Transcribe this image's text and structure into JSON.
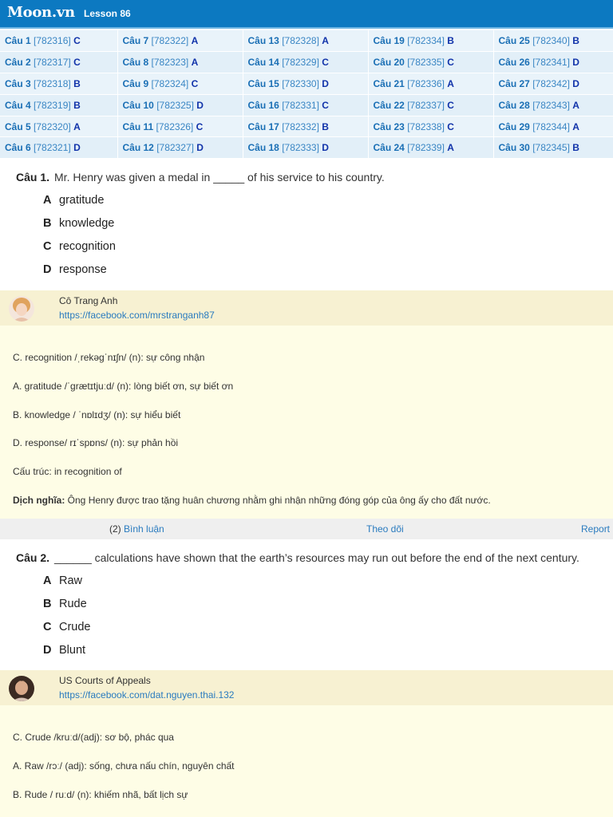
{
  "header": {
    "logo": "Moon.vn",
    "lesson": "Lesson 86"
  },
  "answer_grid": [
    [
      {
        "num": "Câu 1",
        "id": "[782316]",
        "key": "C"
      },
      {
        "num": "Câu 7",
        "id": "[782322]",
        "key": "A"
      },
      {
        "num": "Câu 13",
        "id": "[782328]",
        "key": "A"
      },
      {
        "num": "Câu 19",
        "id": "[782334]",
        "key": "B"
      },
      {
        "num": "Câu 25",
        "id": "[782340]",
        "key": "B"
      }
    ],
    [
      {
        "num": "Câu 2",
        "id": "[782317]",
        "key": "C"
      },
      {
        "num": "Câu 8",
        "id": "[782323]",
        "key": "A"
      },
      {
        "num": "Câu 14",
        "id": "[782329]",
        "key": "C"
      },
      {
        "num": "Câu 20",
        "id": "[782335]",
        "key": "C"
      },
      {
        "num": "Câu 26",
        "id": "[782341]",
        "key": "D"
      }
    ],
    [
      {
        "num": "Câu 3",
        "id": "[782318]",
        "key": "B"
      },
      {
        "num": "Câu 9",
        "id": "[782324]",
        "key": "C"
      },
      {
        "num": "Câu 15",
        "id": "[782330]",
        "key": "D"
      },
      {
        "num": "Câu 21",
        "id": "[782336]",
        "key": "A"
      },
      {
        "num": "Câu 27",
        "id": "[782342]",
        "key": "D"
      }
    ],
    [
      {
        "num": "Câu 4",
        "id": "[782319]",
        "key": "B"
      },
      {
        "num": "Câu 10",
        "id": "[782325]",
        "key": "D"
      },
      {
        "num": "Câu 16",
        "id": "[782331]",
        "key": "C"
      },
      {
        "num": "Câu 22",
        "id": "[782337]",
        "key": "C"
      },
      {
        "num": "Câu 28",
        "id": "[782343]",
        "key": "A"
      }
    ],
    [
      {
        "num": "Câu 5",
        "id": "[782320]",
        "key": "A"
      },
      {
        "num": "Câu 11",
        "id": "[782326]",
        "key": "C"
      },
      {
        "num": "Câu 17",
        "id": "[782332]",
        "key": "B"
      },
      {
        "num": "Câu 23",
        "id": "[782338]",
        "key": "C"
      },
      {
        "num": "Câu 29",
        "id": "[782344]",
        "key": "A"
      }
    ],
    [
      {
        "num": "Câu 6",
        "id": "[782321]",
        "key": "D"
      },
      {
        "num": "Câu 12",
        "id": "[782327]",
        "key": "D"
      },
      {
        "num": "Câu 18",
        "id": "[782333]",
        "key": "D"
      },
      {
        "num": "Câu 24",
        "id": "[782339]",
        "key": "A"
      },
      {
        "num": "Câu 30",
        "id": "[782345]",
        "key": "B"
      }
    ]
  ],
  "questions": [
    {
      "label": "Câu 1.",
      "text": "Mr. Henry was given a medal in _____ of his service to his country.",
      "options": [
        {
          "letter": "A",
          "text": "gratitude"
        },
        {
          "letter": "B",
          "text": "knowledge"
        },
        {
          "letter": "C",
          "text": "recognition"
        },
        {
          "letter": "D",
          "text": "response"
        }
      ],
      "author": {
        "name": "Cô Trang Anh",
        "link": "https://facebook.com/mrstranganh87"
      },
      "explanation": [
        {
          "bold": "",
          "text": "C. recognition /ˌrekəgˈnɪʃn/ (n): sự công nhận"
        },
        {
          "bold": "",
          "text": "A. gratitude /ˈgrætɪtjuːd/ (n): lòng biết ơn, sự biết ơn"
        },
        {
          "bold": "",
          "text": "B. knowledge / ˈnɒlɪdʒ/ (n): sự hiểu biết"
        },
        {
          "bold": "",
          "text": "D. response/ rɪˈspɒns/ (n): sự phản hồi"
        },
        {
          "bold": "",
          "text": "Cấu trúc: in recognition of"
        },
        {
          "bold": "Dịch nghĩa:",
          "text": " Ông Henry được trao tặng huân chương nhằm ghi nhận những đóng góp của ông ấy cho đất nước."
        }
      ],
      "actions": {
        "comment_count": "(2)",
        "comment": "Bình luận",
        "follow": "Theo dõi",
        "report": "Report"
      }
    },
    {
      "label": "Câu 2.",
      "text": "______ calculations have shown that the earth’s resources may run out before the end of the next century.",
      "options": [
        {
          "letter": "A",
          "text": "Raw"
        },
        {
          "letter": "B",
          "text": "Rude"
        },
        {
          "letter": "C",
          "text": "Crude"
        },
        {
          "letter": "D",
          "text": "Blunt"
        }
      ],
      "author": {
        "name": "US Courts of Appeals",
        "link": "https://facebook.com/dat.nguyen.thai.132"
      },
      "explanation": [
        {
          "bold": "",
          "text": "C. Crude /kruːd/(adj): sơ bộ, phác qua"
        },
        {
          "bold": "",
          "text": "A. Raw /rɔː/ (adj): sống, chưa nấu chín, nguyên chất"
        },
        {
          "bold": "",
          "text": "B. Rude / ruːd/ (n): khiếm nhã, bất lịch sự"
        }
      ]
    }
  ],
  "colors": {
    "header_bg": "#0c79c1",
    "author_bg": "#f7f1d2",
    "explain_bg": "#fefde6",
    "link": "#2a7bbf",
    "answer_key": "#1133aa"
  }
}
